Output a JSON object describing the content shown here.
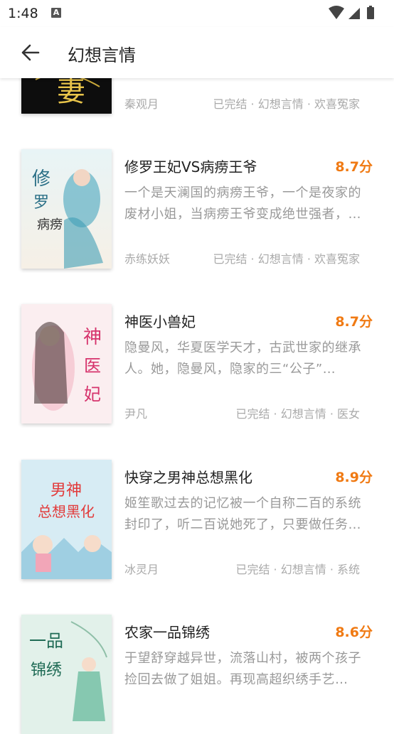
{
  "status_bar": {
    "time": "1:48",
    "notif_letter": "A"
  },
  "app_bar": {
    "title": "幻想言情"
  },
  "books": [
    {
      "title": "",
      "rating": "",
      "desc": "",
      "author": "秦观月",
      "meta": "已完结 · 幻想言情 · 欢喜冤家",
      "cover_text": "妻",
      "cover_color": "#111111"
    },
    {
      "title": "修罗王妃VS病痨王爷",
      "rating": "8.7分",
      "desc": "一个是天澜国的病痨王爷，一个是夜家的废材小姐，当病痨王爷变成绝世强者，废材小姐变身天才…",
      "author": "赤练妖妖",
      "meta": "已完结 · 幻想言情 · 欢喜冤家",
      "cover_text": "修罗王妃",
      "cover_color": "#a8d4e0"
    },
    {
      "title": "神医小兽妃",
      "rating": "8.7分",
      "desc": "隐曼风，华夏医学天才，古武世家的继承人。她，隐曼风，隐家的三“公子”…",
      "author": "尹凡",
      "meta": "已完结 · 幻想言情 · 医女",
      "cover_text": "神医小兽妃",
      "cover_color": "#f0c8cc"
    },
    {
      "title": "快穿之男神总想黑化",
      "rating": "8.9分",
      "desc": "姬笙歌过去的记忆被一个自称二百的系统封印了，听二百说她死了，只要做任务就能复活…",
      "author": "冰灵月",
      "meta": "已完结 · 幻想言情 · 系统",
      "cover_text": "男神总想黑化",
      "cover_color": "#bfe0ee"
    },
    {
      "title": "农家一品锦绣",
      "rating": "8.6分",
      "desc": "于望舒穿越异世，流落山村，被两个孩子捡回去做了姐姐。再现高超织绣手艺…",
      "author": "",
      "meta": "",
      "cover_text": "一品锦绣",
      "cover_color": "#cfe6dc"
    }
  ]
}
